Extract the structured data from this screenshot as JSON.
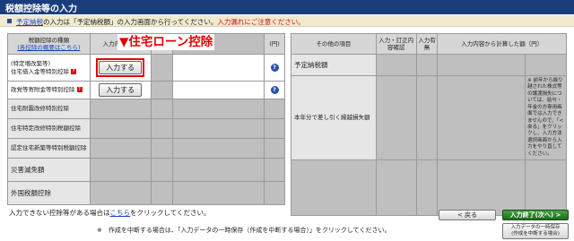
{
  "header": {
    "title": "税額控除等の入力"
  },
  "notice": {
    "link": "予定納税",
    "text": "の入力は「予定納税額」の入力画面から行ってください。",
    "warning": "入力漏れにご注意ください。"
  },
  "callout": "▼住宅ローン控除",
  "left_table": {
    "headers": {
      "type_line1": "税額控除の種類",
      "type_link": "(各控除の概要はこちら)",
      "input_status": "入力内容確認",
      "input": "入力",
      "amount": "(円)"
    },
    "rows": [
      {
        "line1": "(特定増改築等)",
        "line2": "住宅借入金等特別控除",
        "button": "入力する"
      },
      {
        "label": "政党等寄附金等特別控除",
        "button": "入力する"
      },
      {
        "label": "住宅耐震改修特別控除"
      },
      {
        "label": "住宅特定改修特別税額控除"
      },
      {
        "label": "認定住宅新築等特別税額控除"
      },
      {
        "label": "災害減免額"
      },
      {
        "label": "外国税額控除"
      }
    ]
  },
  "right_table": {
    "headers": {
      "item": "その他の項目",
      "input_status": "入力・訂正内容確認",
      "input_presence": "入力有無",
      "amount": "入力内容から計算した額（円）"
    },
    "rows": [
      {
        "label": "予定納税額"
      },
      {
        "label": "本年分で差し引く繰越損失額",
        "note": "※ 前年から繰り越された株式等の譲渡損失については、給与・年金の方専用画面では入力できませんので、「< 戻る」をクリックし、入力方法選択画面から入力をやり直してください。"
      }
    ]
  },
  "footer": {
    "line1_before": "入力できない控除等がある場合は",
    "line1_link": "こちら",
    "line1_after": "をクリックしてください。",
    "line2": "※　作成を中断する場合は、「入力データの一時保存（作成を中断する場合）」をクリックしてください。"
  },
  "buttons": {
    "back": "< 戻る",
    "next": "入力終了(次へ) >",
    "save_line1": "入力データの一時保存",
    "save_line2": "(作成を中断する場合)"
  }
}
